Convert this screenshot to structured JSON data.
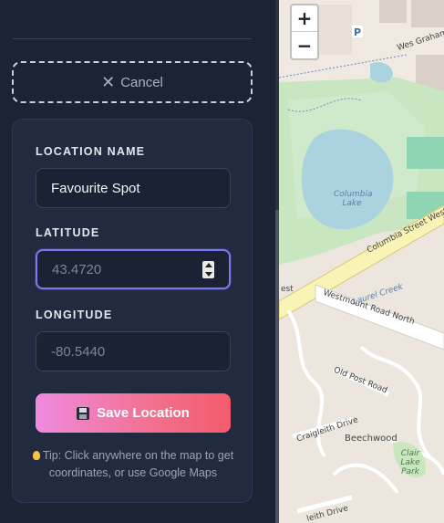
{
  "form": {
    "cancel_label": "Cancel",
    "location_name_label": "LOCATION NAME",
    "location_name_value": "Favourite Spot",
    "latitude_label": "LATITUDE",
    "latitude_placeholder": "43.4720",
    "longitude_label": "LONGITUDE",
    "longitude_placeholder": "-80.5440",
    "save_label": "Save Location",
    "tip_text": "Tip: Click anywhere on the map to get coordinates, or use Google Maps"
  },
  "map": {
    "zoom_in": "+",
    "zoom_out": "−",
    "parking_label": "P",
    "labels": {
      "west_graham": "Wes Graham Way",
      "columbia_lake": "Columbia Lake",
      "columbia_street": "Columbia Street West",
      "laurel_creek": "Laurel Creek",
      "westmount": "Westmount Road North",
      "old_post": "Old Post Road",
      "craigleith": "Craigleith Drive",
      "beechwood": "Beechwood",
      "clair_lake": "Clair Lake Park",
      "est": "est",
      "bottom_drive": "leith Drive"
    }
  },
  "colors": {
    "accent_focus": "#7d78f0",
    "save_gradient_start": "#f08be0",
    "save_gradient_end": "#f35a6c",
    "panel_bg": "#1c2335",
    "card_bg": "#212a3f"
  }
}
